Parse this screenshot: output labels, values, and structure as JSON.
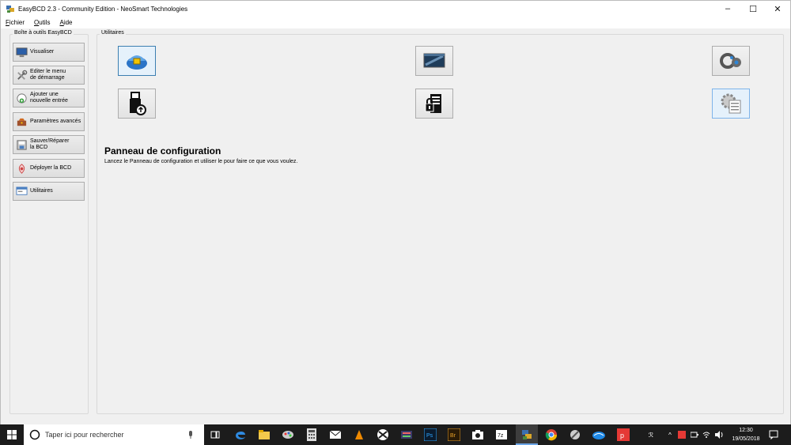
{
  "window": {
    "title": "EasyBCD 2.3 - Community Edition - NeoSmart Technologies"
  },
  "menu": [
    "Fichier",
    "Outils",
    "Aide"
  ],
  "toolbox": {
    "label": "Boîte à outils EasyBCD",
    "buttons": [
      {
        "label": "Visualiser",
        "icon": "monitor-icon"
      },
      {
        "label": "Editer le menu\nde démarrage",
        "icon": "tools-icon"
      },
      {
        "label": "Ajouter une\nnouvelle entrée",
        "icon": "add-icon"
      },
      {
        "label": "Paramètres avancés",
        "icon": "toolbox-icon"
      },
      {
        "label": "Sauver/Réparer\nla BCD",
        "icon": "save-icon"
      },
      {
        "label": "Déployer la BCD",
        "icon": "deploy-icon"
      },
      {
        "label": "Utilitaires",
        "icon": "utilities-icon"
      }
    ]
  },
  "utilities": {
    "label": "Utilitaires",
    "icons": [
      "security-shield-icon",
      "terminal-console-icon",
      "gears-icon",
      "usb-drive-icon",
      "locked-server-icon",
      "control-panel-icon"
    ],
    "selected_title": "Panneau de configuration",
    "selected_desc": "Lancez le Panneau de configuration et utiliser le pour faire ce que vous voulez."
  },
  "taskbar": {
    "search_placeholder": "Taper ici pour rechercher",
    "time": "12:30",
    "date": "19/05/2018"
  }
}
